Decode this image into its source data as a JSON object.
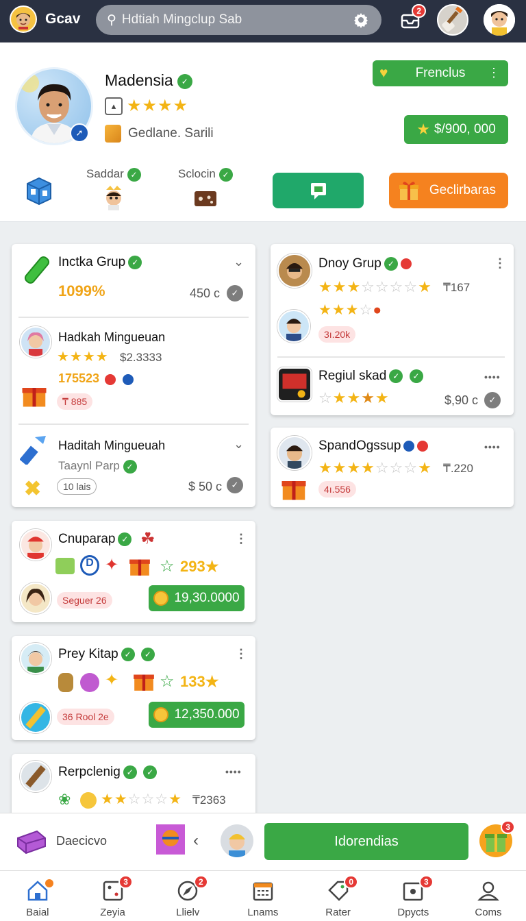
{
  "topbar": {
    "title": "Gcav",
    "search_placeholder": "Hdtiah Mingclup Sab",
    "inbox_badge": "2"
  },
  "profile": {
    "name": "Madensia",
    "rating_stars": 4,
    "subtitle": "Gedlane. Sarili",
    "friends_label": "Frenclus",
    "balance": "$/900, 000",
    "friend1": "Saddar",
    "friend2": "Sclocin",
    "gifts_label": "Geclirbaras"
  },
  "cards": {
    "group1": {
      "title": "Inctka Grup",
      "percent": "1099%",
      "price": "450 c"
    },
    "person1": {
      "title": "Hadkah Minguеuan",
      "rating": "$2.3333",
      "number": "175523",
      "tag": "₸ 885"
    },
    "group2": {
      "title": "Haditah Mingueuah",
      "subtitle": "Taaynl Parp",
      "tag": "10 lais",
      "price": "$ 50 c"
    },
    "chat1": {
      "title": "Cnuparap",
      "score": "293",
      "tag": "Seguer 26",
      "amount": "19,30.0000"
    },
    "chat2": {
      "title": "Prey Kitap",
      "score": "133",
      "tag": "36 Rool 2e",
      "amount": "12,350.000"
    },
    "chat3": {
      "title": "Rerpclenig",
      "count": "₸2363"
    },
    "right1": {
      "title": "Dnoy Grup",
      "count": "₸167",
      "tag": "3ı.20k"
    },
    "right2": {
      "title": "Regiul skad",
      "price": "$,90 c"
    },
    "right3": {
      "title": "SpandOgssup",
      "count": "₸.220",
      "tag": "4ı.556"
    }
  },
  "actionbar": {
    "label": "Daecicvo",
    "main_button": "Idorendias",
    "gift_badge": "3"
  },
  "nav": {
    "items": [
      {
        "label": "Baial",
        "badge": ""
      },
      {
        "label": "Zeyia",
        "badge": "3"
      },
      {
        "label": "Llielv",
        "badge": "2"
      },
      {
        "label": "Lnams",
        "badge": ""
      },
      {
        "label": "Rater",
        "badge": "0"
      },
      {
        "label": "Dpycts",
        "badge": "3"
      },
      {
        "label": "Coms",
        "badge": ""
      }
    ]
  },
  "colors": {
    "primary_green": "#3aa845",
    "teal": "#20a86a",
    "orange": "#f5821f",
    "topbar": "#2a3142",
    "gold": "#f3b415"
  }
}
